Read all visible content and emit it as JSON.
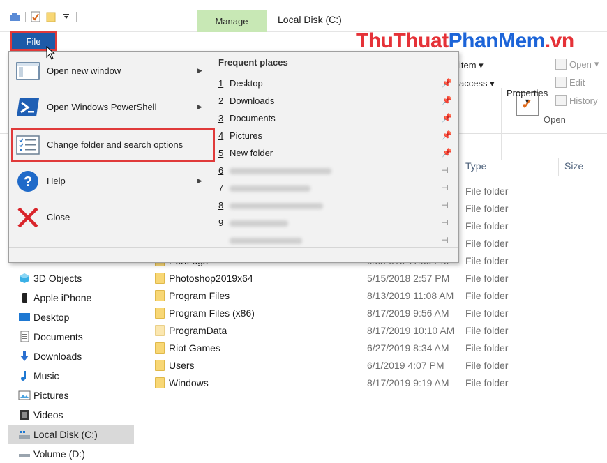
{
  "window": {
    "title": "Local Disk (C:)",
    "manage_tab": "Manage"
  },
  "watermark": {
    "part1": "ThuThuat",
    "part2": "PhanMem",
    "part3": ".vn"
  },
  "ribbon": {
    "select_item": "item",
    "easy_access": "access",
    "properties_label": "Properties",
    "open_label": "Open",
    "edit_label": "Edit",
    "history_label": "History",
    "open_group": "Open"
  },
  "columns": {
    "type": "Type",
    "size": "Size"
  },
  "file_menu": {
    "file_button": "File",
    "items": [
      {
        "label": "Open new window"
      },
      {
        "label": "Open Windows PowerShell"
      },
      {
        "label": "Change folder and search options"
      },
      {
        "label": "Help"
      },
      {
        "label": "Close"
      }
    ],
    "frequent_title": "Frequent places",
    "frequent": [
      {
        "num": "1",
        "name": "Desktop"
      },
      {
        "num": "2",
        "name": "Downloads"
      },
      {
        "num": "3",
        "name": "Documents"
      },
      {
        "num": "4",
        "name": "Pictures"
      },
      {
        "num": "5",
        "name": "New folder"
      },
      {
        "num": "6",
        "name": ""
      },
      {
        "num": "7",
        "name": ""
      },
      {
        "num": "8",
        "name": ""
      },
      {
        "num": "9",
        "name": ""
      },
      {
        "num": "",
        "name": ""
      }
    ]
  },
  "hidden_types": [
    "File folder",
    "File folder",
    "File folder",
    "File folder"
  ],
  "files": [
    {
      "name": "PerfLogs",
      "date": "9/3/2019 11:30 PM",
      "type": "File folder"
    },
    {
      "name": "Photoshop2019x64",
      "date": "5/15/2018 2:57 PM",
      "type": "File folder"
    },
    {
      "name": "Program Files",
      "date": "8/13/2019 11:08 AM",
      "type": "File folder"
    },
    {
      "name": "Program Files (x86)",
      "date": "8/17/2019 9:56 AM",
      "type": "File folder"
    },
    {
      "name": "ProgramData",
      "date": "8/17/2019 10:10 AM",
      "type": "File folder"
    },
    {
      "name": "Riot Games",
      "date": "6/27/2019 8:34 AM",
      "type": "File folder"
    },
    {
      "name": "Users",
      "date": "6/1/2019 4:07 PM",
      "type": "File folder"
    },
    {
      "name": "Windows",
      "date": "8/17/2019 9:19 AM",
      "type": "File folder"
    }
  ],
  "nav": [
    {
      "label": "3D Objects",
      "icon": "3d-objects-icon"
    },
    {
      "label": "Apple iPhone",
      "icon": "phone-icon"
    },
    {
      "label": "Desktop",
      "icon": "desktop-icon"
    },
    {
      "label": "Documents",
      "icon": "documents-icon"
    },
    {
      "label": "Downloads",
      "icon": "download-arrow-icon"
    },
    {
      "label": "Music",
      "icon": "music-note-icon"
    },
    {
      "label": "Pictures",
      "icon": "pictures-icon"
    },
    {
      "label": "Videos",
      "icon": "film-icon"
    },
    {
      "label": "Local Disk (C:)",
      "icon": "drive-icon"
    },
    {
      "label": "Volume (D:)",
      "icon": "drive-icon"
    }
  ],
  "colors": {
    "file_button": "#1d5aa8",
    "highlight": "#e03a3a",
    "manage_tab": "#c8e8b5",
    "menu_bg": "#f2f2f2"
  }
}
